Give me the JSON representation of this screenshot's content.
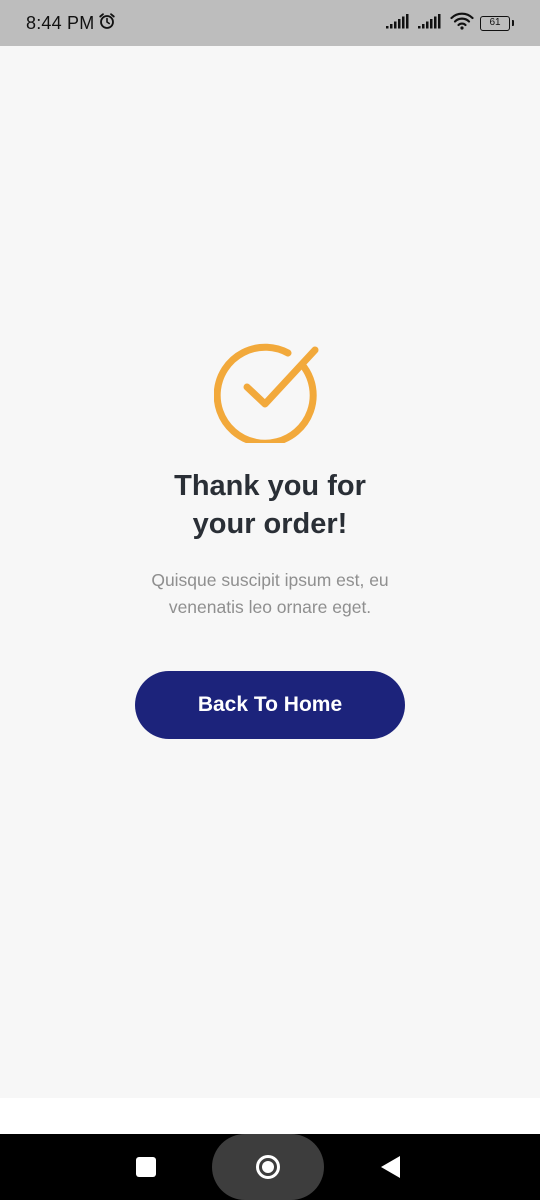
{
  "status_bar": {
    "time": "8:44 PM",
    "battery_level": "61",
    "icons": [
      "alarm-icon",
      "signal-icon",
      "signal-icon",
      "wifi-icon",
      "battery-icon"
    ]
  },
  "confirmation": {
    "icon": "check-circle-icon",
    "icon_color": "#f2a93b",
    "title_line1": "Thank you for",
    "title_line2": "your order!",
    "message_line1": "Quisque suscipit ipsum est, eu",
    "message_line2": "venenatis leo ornare eget.",
    "button_label": "Back To Home",
    "button_color": "#1c237b"
  },
  "nav_bar": {
    "icons": [
      "recent-apps-icon",
      "home-icon",
      "back-icon"
    ]
  }
}
